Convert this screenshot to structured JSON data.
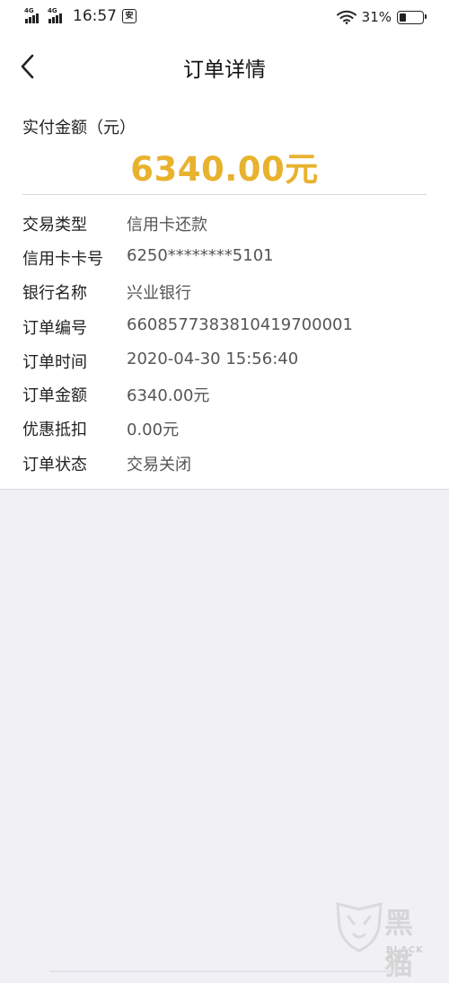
{
  "status_bar": {
    "signal1": "4G",
    "signal2": "4G",
    "time": "16:57",
    "app_badge": "安",
    "wifi_icon": "wifi-icon",
    "battery_percent": "31%",
    "battery_level": 0.31
  },
  "nav": {
    "back_icon": "chevron-left-icon",
    "title": "订单详情"
  },
  "summary": {
    "label": "实付金额（元）",
    "amount": "6340.00元",
    "amount_color": "#e8b22e"
  },
  "details": [
    {
      "label": "交易类型",
      "value": "信用卡还款"
    },
    {
      "label": "信用卡卡号",
      "value": "6250********5101"
    },
    {
      "label": "银行名称",
      "value": "兴业银行"
    },
    {
      "label": "订单编号",
      "value": "6608577383810419700001"
    },
    {
      "label": "订单时间",
      "value": "2020-04-30 15:56:40"
    },
    {
      "label": "订单金额",
      "value": "6340.00元"
    },
    {
      "label": "优惠抵扣",
      "value": "0.00元"
    },
    {
      "label": "订单状态",
      "value": "交易关闭"
    }
  ],
  "watermark": {
    "text": "黑猫",
    "subtext": "BLACK CAT"
  }
}
